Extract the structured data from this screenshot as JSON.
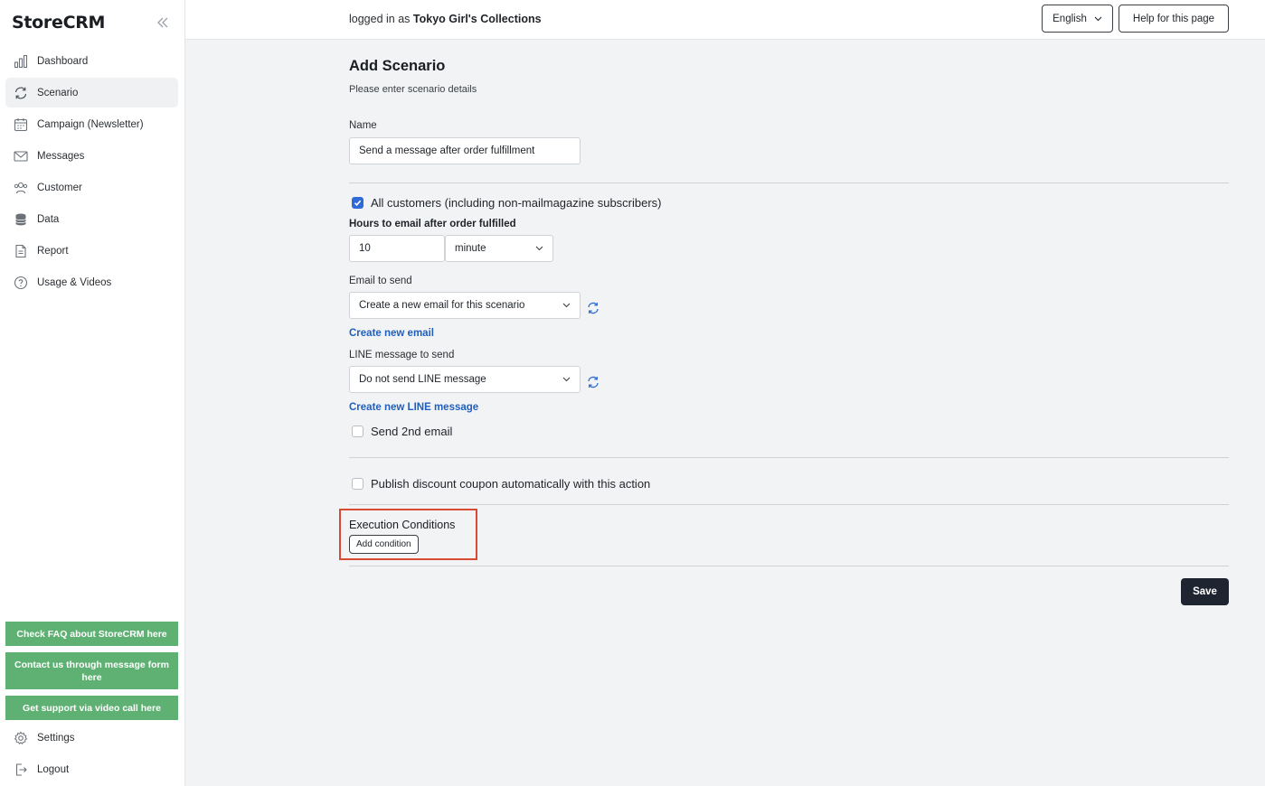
{
  "app": {
    "name": "StoreCRM"
  },
  "sidebar": {
    "items": [
      {
        "label": "Dashboard",
        "icon": "bar-chart-icon"
      },
      {
        "label": "Scenario",
        "icon": "refresh-icon"
      },
      {
        "label": "Campaign (Newsletter)",
        "icon": "calendar-icon"
      },
      {
        "label": "Messages",
        "icon": "envelope-icon"
      },
      {
        "label": "Customer",
        "icon": "users-icon"
      },
      {
        "label": "Data",
        "icon": "database-icon"
      },
      {
        "label": "Report",
        "icon": "document-icon"
      },
      {
        "label": "Usage & Videos",
        "icon": "help-circle-icon"
      }
    ],
    "active": "Scenario",
    "support_buttons": {
      "faq": "Check FAQ about StoreCRM here",
      "contact": "Contact us through message form here",
      "video": "Get support via video call here"
    },
    "settings_label": "Settings",
    "logout_label": "Logout"
  },
  "header": {
    "logged_prefix": "logged in as",
    "store_name": "Tokyo Girl's Collections",
    "language": "English",
    "help_label": "Help for this page"
  },
  "form": {
    "title": "Add Scenario",
    "subtitle": "Please enter scenario details",
    "name_label": "Name",
    "name_value": "Send a message after order fulfillment",
    "all_customers_label": "All customers (including non-mailmagazine subscribers)",
    "all_customers_checked": true,
    "hours_label": "Hours to email after order fulfilled",
    "hours_value": "10",
    "unit_value": "minute",
    "email_label": "Email to send",
    "email_value": "Create a new email for this scenario",
    "create_email_link": "Create new email",
    "line_label": "LINE message to send",
    "line_value": "Do not send LINE message",
    "create_line_link": "Create new LINE message",
    "second_email_label": "Send 2nd email",
    "second_email_checked": false,
    "coupon_label": "Publish discount coupon automatically with this action",
    "coupon_checked": false,
    "exec_title": "Execution Conditions",
    "add_condition_label": "Add condition",
    "save_label": "Save"
  },
  "colors": {
    "accent_blue": "#2f6bd7",
    "support_green": "#5fb173",
    "highlight_red": "#d94a33",
    "save_dark": "#1f2530"
  }
}
